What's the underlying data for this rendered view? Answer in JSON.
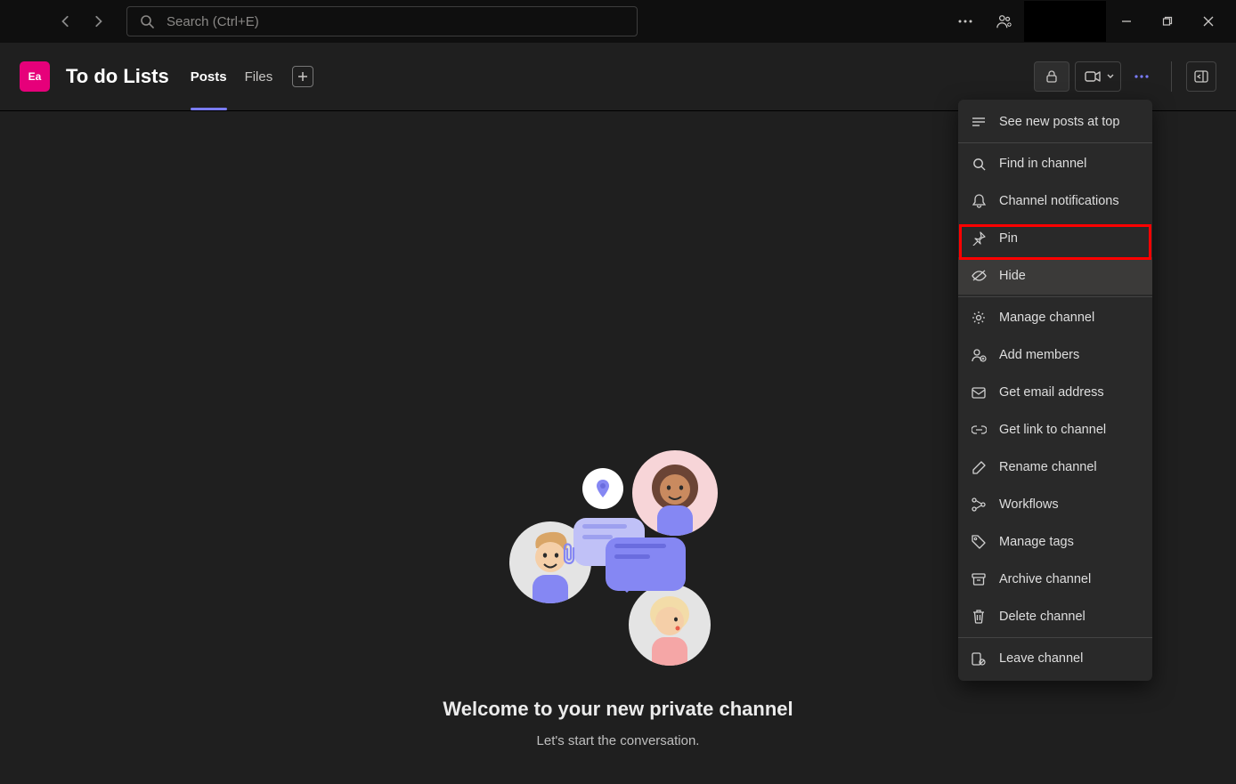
{
  "titlebar": {
    "search_placeholder": "Search (Ctrl+E)"
  },
  "header": {
    "avatar_text": "Ea",
    "channel_name": "To do Lists",
    "tabs": {
      "posts": "Posts",
      "files": "Files"
    }
  },
  "empty_state": {
    "title": "Welcome to your new private channel",
    "subtitle": "Let's start the conversation."
  },
  "menu": {
    "see_new_posts": "See new posts at top",
    "find_in_channel": "Find in channel",
    "channel_notifications": "Channel notifications",
    "pin": "Pin",
    "hide": "Hide",
    "manage_channel": "Manage channel",
    "add_members": "Add members",
    "get_email": "Get email address",
    "get_link": "Get link to channel",
    "rename": "Rename channel",
    "workflows": "Workflows",
    "manage_tags": "Manage tags",
    "archive": "Archive channel",
    "delete": "Delete channel",
    "leave": "Leave channel"
  }
}
